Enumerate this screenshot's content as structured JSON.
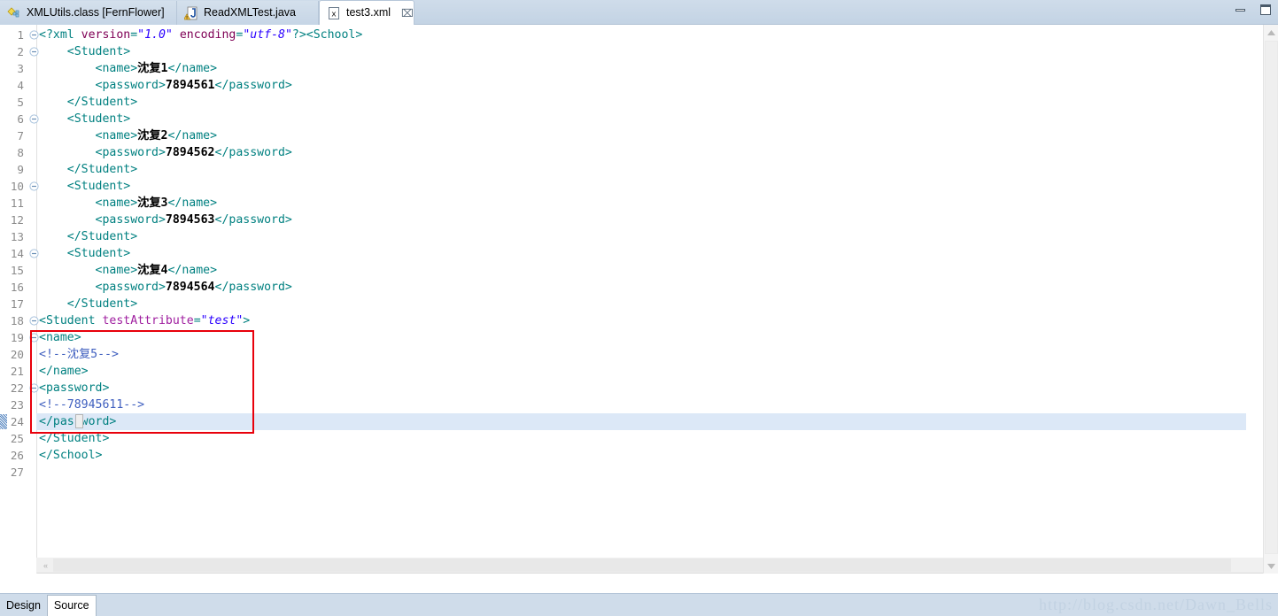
{
  "window": {
    "minimize_label": "Minimize",
    "maximize_label": "Maximize"
  },
  "tabs": [
    {
      "label": "XMLUtils.class [FernFlower]",
      "icon": "class-file-icon",
      "active": false,
      "closable": false
    },
    {
      "label": "ReadXMLTest.java",
      "icon": "java-file-warning-icon",
      "active": false,
      "closable": false
    },
    {
      "label": "test3.xml",
      "icon": "xml-file-icon",
      "active": true,
      "closable": true,
      "close_glyph": "⌧"
    }
  ],
  "editor": {
    "current_line": 24,
    "total_lines": 27,
    "lines": [
      {
        "n": 1,
        "fold": "collapse",
        "tokens": [
          {
            "t": "<?xml ",
            "c": "tg"
          },
          {
            "t": "version",
            "c": "at"
          },
          {
            "t": "=",
            "c": "tg"
          },
          {
            "t": "\"1.0\"",
            "c": "va"
          },
          {
            "t": " ",
            "c": "tg"
          },
          {
            "t": "encoding",
            "c": "at"
          },
          {
            "t": "=",
            "c": "tg"
          },
          {
            "t": "\"utf-8\"",
            "c": "va"
          },
          {
            "t": "?>",
            "c": "tg"
          },
          {
            "t": "<School>",
            "c": "tg"
          }
        ]
      },
      {
        "n": 2,
        "fold": "collapse",
        "tokens": [
          {
            "t": "    <Student>",
            "c": "tg"
          }
        ]
      },
      {
        "n": 3,
        "fold": "",
        "tokens": [
          {
            "t": "        <name>",
            "c": "tg"
          },
          {
            "t": "沈复1",
            "c": "tx"
          },
          {
            "t": "</name>",
            "c": "tg"
          }
        ]
      },
      {
        "n": 4,
        "fold": "",
        "tokens": [
          {
            "t": "        <password>",
            "c": "tg"
          },
          {
            "t": "7894561",
            "c": "tx"
          },
          {
            "t": "</password>",
            "c": "tg"
          }
        ]
      },
      {
        "n": 5,
        "fold": "",
        "tokens": [
          {
            "t": "    </Student>",
            "c": "tg"
          }
        ]
      },
      {
        "n": 6,
        "fold": "collapse",
        "tokens": [
          {
            "t": "    <Student>",
            "c": "tg"
          }
        ]
      },
      {
        "n": 7,
        "fold": "",
        "tokens": [
          {
            "t": "        <name>",
            "c": "tg"
          },
          {
            "t": "沈复2",
            "c": "tx"
          },
          {
            "t": "</name>",
            "c": "tg"
          }
        ]
      },
      {
        "n": 8,
        "fold": "",
        "tokens": [
          {
            "t": "        <password>",
            "c": "tg"
          },
          {
            "t": "7894562",
            "c": "tx"
          },
          {
            "t": "</password>",
            "c": "tg"
          }
        ]
      },
      {
        "n": 9,
        "fold": "",
        "tokens": [
          {
            "t": "    </Student>",
            "c": "tg"
          }
        ]
      },
      {
        "n": 10,
        "fold": "collapse",
        "tokens": [
          {
            "t": "    <Student>",
            "c": "tg"
          }
        ]
      },
      {
        "n": 11,
        "fold": "",
        "tokens": [
          {
            "t": "        <name>",
            "c": "tg"
          },
          {
            "t": "沈复3",
            "c": "tx"
          },
          {
            "t": "</name>",
            "c": "tg"
          }
        ]
      },
      {
        "n": 12,
        "fold": "",
        "tokens": [
          {
            "t": "        <password>",
            "c": "tg"
          },
          {
            "t": "7894563",
            "c": "tx"
          },
          {
            "t": "</password>",
            "c": "tg"
          }
        ]
      },
      {
        "n": 13,
        "fold": "",
        "tokens": [
          {
            "t": "    </Student>",
            "c": "tg"
          }
        ]
      },
      {
        "n": 14,
        "fold": "collapse",
        "tokens": [
          {
            "t": "    <Student>",
            "c": "tg"
          }
        ]
      },
      {
        "n": 15,
        "fold": "",
        "tokens": [
          {
            "t": "        <name>",
            "c": "tg"
          },
          {
            "t": "沈复4",
            "c": "tx"
          },
          {
            "t": "</name>",
            "c": "tg"
          }
        ]
      },
      {
        "n": 16,
        "fold": "",
        "tokens": [
          {
            "t": "        <password>",
            "c": "tg"
          },
          {
            "t": "7894564",
            "c": "tx"
          },
          {
            "t": "</password>",
            "c": "tg"
          }
        ]
      },
      {
        "n": 17,
        "fold": "",
        "tokens": [
          {
            "t": "    </Student>",
            "c": "tg"
          }
        ]
      },
      {
        "n": 18,
        "fold": "collapse",
        "tokens": [
          {
            "t": "<Student ",
            "c": "tg"
          },
          {
            "t": "testAttribute",
            "c": "atp"
          },
          {
            "t": "=",
            "c": "tg"
          },
          {
            "t": "\"test\"",
            "c": "va"
          },
          {
            "t": ">",
            "c": "tg"
          }
        ]
      },
      {
        "n": 19,
        "fold": "collapse",
        "tokens": [
          {
            "t": "<name>",
            "c": "tg"
          }
        ]
      },
      {
        "n": 20,
        "fold": "",
        "tokens": [
          {
            "t": "<!--沈复5-->",
            "c": "cm"
          }
        ]
      },
      {
        "n": 21,
        "fold": "",
        "tokens": [
          {
            "t": "</name>",
            "c": "tg"
          }
        ]
      },
      {
        "n": 22,
        "fold": "collapse",
        "tokens": [
          {
            "t": "<password>",
            "c": "tg"
          }
        ]
      },
      {
        "n": 23,
        "fold": "",
        "tokens": [
          {
            "t": "<!--78945611-->",
            "c": "cm"
          }
        ]
      },
      {
        "n": 24,
        "fold": "",
        "tokens": [
          {
            "t": "</password>",
            "c": "tg"
          }
        ]
      },
      {
        "n": 25,
        "fold": "",
        "tokens": [
          {
            "t": "</Student>",
            "c": "tg"
          }
        ]
      },
      {
        "n": 26,
        "fold": "",
        "tokens": [
          {
            "t": "</School>",
            "c": "tg"
          }
        ]
      },
      {
        "n": 27,
        "fold": "",
        "tokens": [
          {
            "t": "",
            "c": "tg"
          }
        ]
      }
    ],
    "annotation": {
      "shape": "rectangle",
      "color": "#e8000b",
      "covers_lines": "19-24"
    }
  },
  "scrollbars": {
    "vertical_up": "▲",
    "vertical_down": "▼",
    "horizontal_left": "«",
    "horizontal_right": "»"
  },
  "bottom_tabs": [
    {
      "label": "Design",
      "active": false
    },
    {
      "label": "Source",
      "active": true
    }
  ],
  "watermark": "http://blog.csdn.net/Dawn_Bells",
  "colors": {
    "tag": "#008080",
    "attribute": "#7f0055",
    "attribute_alt": "#a020a0",
    "value": "#2a00ff",
    "comment": "#3f5fbf",
    "text": "#000000",
    "current_line_bg": "#dce8f7",
    "chrome": "#cfdcea"
  }
}
